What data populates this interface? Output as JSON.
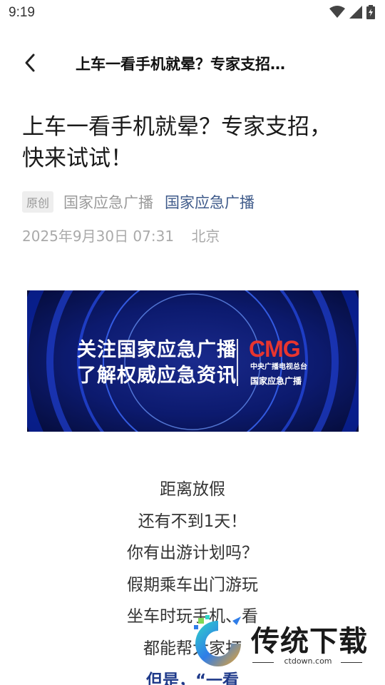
{
  "status_bar": {
    "time": "9:19"
  },
  "nav": {
    "title": "上车一看手机就晕？专家支招…"
  },
  "article": {
    "title_line1": "上车一看手机就晕？专家支招，",
    "title_line2": "快来试试！",
    "badge": "原创",
    "source": "国家应急广播",
    "source_link": "国家应急广播",
    "date": "2025年9月30日 07:31",
    "location": "北京"
  },
  "banner": {
    "line1": "关注国家应急广播",
    "line2": "了解权威应急资讯",
    "logo": "CMG",
    "logo_sub": "中央广播电视总台",
    "logo_sub2": "国家应急广播"
  },
  "body": {
    "lines": [
      "距离放假",
      "还有不到1天！",
      "你有出游计划吗？",
      "假期乘车出门游玩",
      "坐车时玩手机、看",
      "都能帮大家打",
      "但是，“一看"
    ]
  },
  "watermark": {
    "name": "传统下载",
    "url": "ctdown.com"
  }
}
